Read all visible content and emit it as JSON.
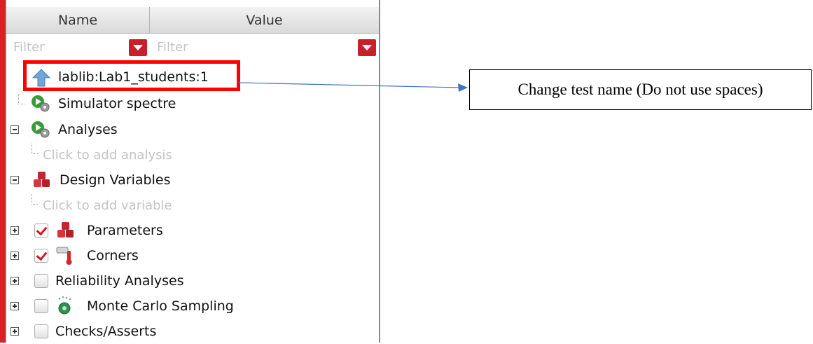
{
  "header": {
    "name_col": "Name",
    "value_col": "Value"
  },
  "filters": {
    "name_placeholder": "Filter",
    "value_placeholder": "Filter"
  },
  "tree": {
    "test_item": "lablib:Lab1_students:1",
    "simulator": "Simulator  spectre",
    "analyses": "Analyses",
    "add_analysis": "Click to add analysis",
    "design_variables": "Design Variables",
    "add_variable": "Click to add variable",
    "parameters": "Parameters",
    "corners": "Corners",
    "reliability": "Reliability Analyses",
    "monte_carlo": "Monte Carlo Sampling",
    "checks": "Checks/Asserts"
  },
  "checked": {
    "parameters": true,
    "corners": true,
    "reliability": false,
    "monte_carlo": false,
    "checks": false
  },
  "annotation": {
    "text": "Change test name (Do not use spaces)"
  },
  "colors": {
    "highlight": "#ff0000",
    "accent_red": "#d01a22",
    "arrow": "#4472c4"
  }
}
